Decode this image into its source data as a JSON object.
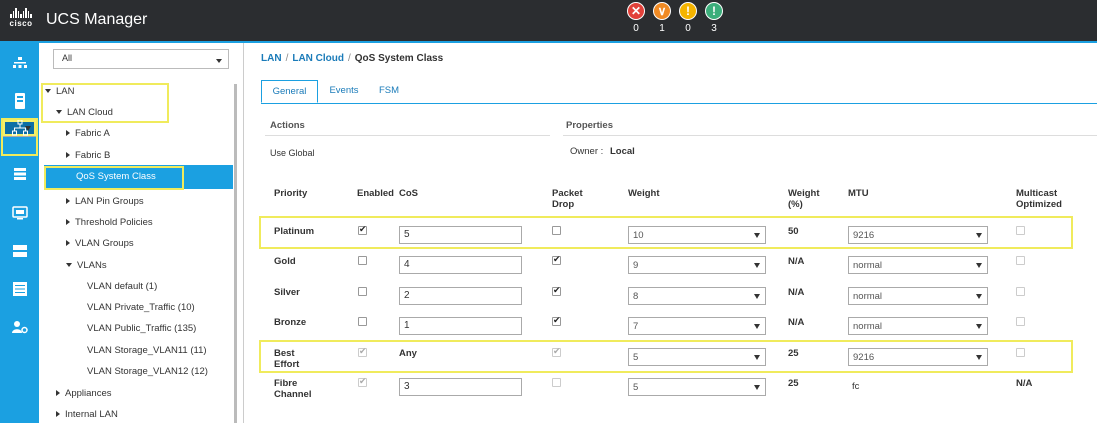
{
  "header": {
    "logo_text": "cisco",
    "app_title": "UCS Manager",
    "faults": [
      {
        "icon": "critical-icon",
        "color": "#e2413a",
        "count": "0"
      },
      {
        "icon": "major-icon",
        "color": "#f08a24",
        "count": "1"
      },
      {
        "icon": "minor-icon",
        "color": "#f5b400",
        "count": "0"
      },
      {
        "icon": "warning-icon",
        "color": "#3cae7b",
        "count": "3"
      }
    ]
  },
  "sidebar_icons": [
    "equipment-icon",
    "servers-icon",
    "lan-icon",
    "san-icon",
    "vm-icon",
    "storage-icon",
    "chassis-icon",
    "admin-icon"
  ],
  "nav": {
    "filter_value": "All",
    "tree": {
      "lan": "LAN",
      "lan_cloud": "LAN Cloud",
      "fabric_a": "Fabric A",
      "fabric_b": "Fabric B",
      "qos": "QoS System Class",
      "lan_pin_groups": "LAN Pin Groups",
      "threshold_policies": "Threshold Policies",
      "vlan_groups": "VLAN Groups",
      "vlans": "VLANs",
      "vlan_default": "VLAN default (1)",
      "vlan_private": "VLAN Private_Traffic (10)",
      "vlan_public": "VLAN Public_Traffic (135)",
      "vlan_storage11": "VLAN Storage_VLAN11 (11)",
      "vlan_storage12": "VLAN Storage_VLAN12 (12)",
      "appliances": "Appliances",
      "internal_lan": "Internal LAN"
    }
  },
  "breadcrumb": {
    "lan": "LAN",
    "lan_cloud": "LAN Cloud",
    "current": "QoS System Class",
    "sep": "/"
  },
  "tabs": {
    "general": "General",
    "events": "Events",
    "fsm": "FSM"
  },
  "actions": {
    "title": "Actions",
    "use_global": "Use Global"
  },
  "properties": {
    "title": "Properties",
    "owner_label": "Owner :",
    "owner_value": "Local"
  },
  "table": {
    "headers": {
      "priority": "Priority",
      "enabled": "Enabled",
      "cos": "CoS",
      "packet_drop_1": "Packet",
      "packet_drop_2": "Drop",
      "weight": "Weight",
      "weight_pct_1": "Weight",
      "weight_pct_2": "(%)",
      "mtu": "MTU",
      "multicast_1": "Multicast",
      "multicast_2": "Optimized"
    },
    "rows": [
      {
        "priority": "Platinum",
        "priority2": "",
        "enabled": true,
        "cos": "5",
        "packet_drop": false,
        "weight": "10",
        "weight_pct": "50",
        "mtu": "9216",
        "multicast": false
      },
      {
        "priority": "Gold",
        "priority2": "",
        "enabled": false,
        "cos": "4",
        "packet_drop": true,
        "weight": "9",
        "weight_pct": "N/A",
        "mtu": "normal",
        "multicast": false
      },
      {
        "priority": "Silver",
        "priority2": "",
        "enabled": false,
        "cos": "2",
        "packet_drop": true,
        "weight": "8",
        "weight_pct": "N/A",
        "mtu": "normal",
        "multicast": false
      },
      {
        "priority": "Bronze",
        "priority2": "",
        "enabled": false,
        "cos": "1",
        "packet_drop": true,
        "weight": "7",
        "weight_pct": "N/A",
        "mtu": "normal",
        "multicast": false
      },
      {
        "priority": "Best",
        "priority2": "Effort",
        "enabled": true,
        "cos": "Any",
        "packet_drop": true,
        "weight": "5",
        "weight_pct": "25",
        "mtu": "9216",
        "multicast": false
      },
      {
        "priority": "Fibre",
        "priority2": "Channel",
        "enabled": true,
        "cos": "3",
        "packet_drop": false,
        "weight": "5",
        "weight_pct": "25",
        "mtu": "fc",
        "multicast": "N/A"
      }
    ]
  }
}
